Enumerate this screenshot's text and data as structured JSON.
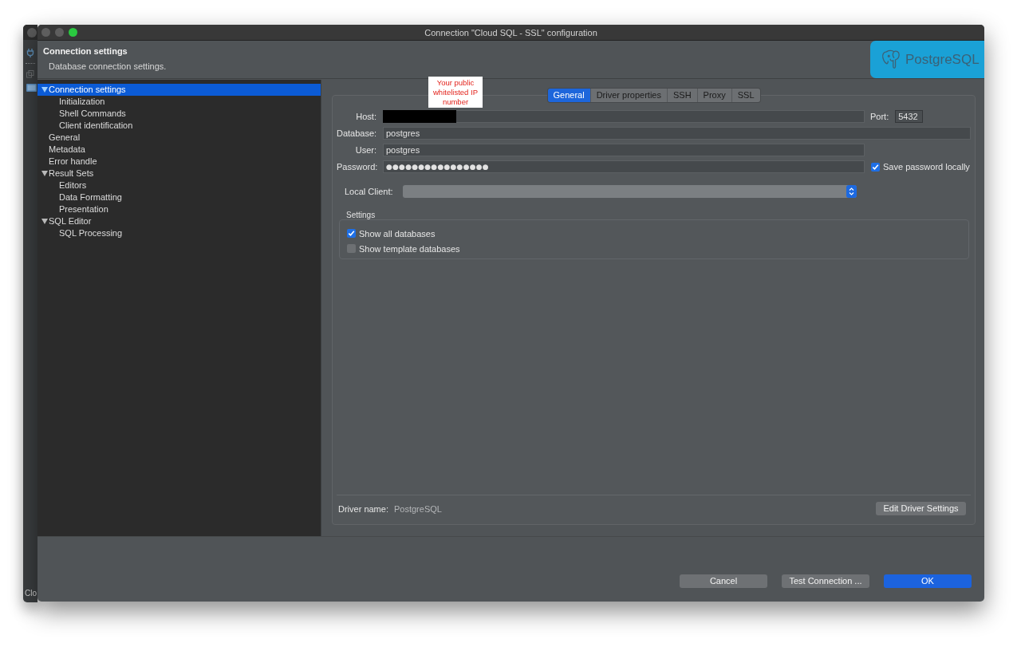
{
  "background_window": {
    "sidebar_label": "Clo"
  },
  "window": {
    "title": "Connection \"Cloud SQL - SSL\" configuration",
    "controls": [
      {
        "kind": "close",
        "disabled": true
      },
      {
        "kind": "minimize",
        "disabled": true
      },
      {
        "kind": "zoom",
        "disabled": false
      }
    ]
  },
  "header": {
    "title": "Connection settings",
    "subtitle": "Database connection settings.",
    "logo_text": "PostgreSQL"
  },
  "navigation": {
    "items": [
      {
        "label": "Connection settings",
        "selected": true,
        "expanded": true,
        "children": [
          {
            "label": "Initialization",
            "selected": false
          },
          {
            "label": "Shell Commands",
            "selected": false
          },
          {
            "label": "Client identification",
            "selected": false
          }
        ]
      },
      {
        "label": "General",
        "selected": false
      },
      {
        "label": "Metadata",
        "selected": false
      },
      {
        "label": "Error handle",
        "selected": false
      },
      {
        "label": "Result Sets",
        "selected": false,
        "expanded": true,
        "children": [
          {
            "label": "Editors",
            "selected": false
          },
          {
            "label": "Data Formatting",
            "selected": false
          },
          {
            "label": "Presentation",
            "selected": false
          }
        ]
      },
      {
        "label": "SQL Editor",
        "selected": false,
        "expanded": true,
        "children": [
          {
            "label": "SQL Processing",
            "selected": false
          }
        ]
      }
    ]
  },
  "annotation": {
    "lines": [
      "Your public",
      "whitelisted IP",
      "number"
    ]
  },
  "tabs": [
    {
      "label": "General",
      "selected": true
    },
    {
      "label": "Driver properties",
      "selected": false
    },
    {
      "label": "SSH",
      "selected": false
    },
    {
      "label": "Proxy",
      "selected": false
    },
    {
      "label": "SSL",
      "selected": false
    }
  ],
  "connection": {
    "host": {
      "label": "Host:",
      "redacted": true
    },
    "port": {
      "label": "Port:",
      "value": "5432"
    },
    "database": {
      "label": "Database:",
      "value": "postgres"
    },
    "user": {
      "label": "User:",
      "value": "postgres"
    },
    "password": {
      "label": "Password:",
      "value": "●●●●●●●●●●●●●●●●"
    },
    "save_password": {
      "label": "Save password locally",
      "checked": true
    },
    "local_client": {
      "label": "Local Client:"
    }
  },
  "settings": {
    "title": "Settings",
    "options": [
      {
        "label": "Show all databases",
        "checked": true
      },
      {
        "label": "Show template databases",
        "checked": false
      }
    ]
  },
  "driver": {
    "label": "Driver name:",
    "value": "PostgreSQL",
    "button": "Edit Driver Settings"
  },
  "buttons": [
    {
      "label": "Cancel",
      "kind": "default"
    },
    {
      "label": "Test Connection ...",
      "kind": "default"
    },
    {
      "label": "OK",
      "kind": "primary"
    }
  ]
}
